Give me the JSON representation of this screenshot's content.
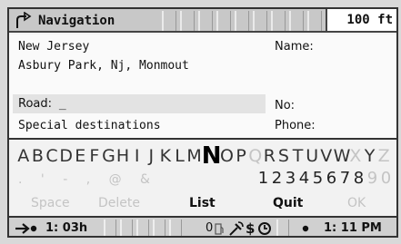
{
  "header": {
    "title": "Navigation",
    "distance": "100 ft",
    "icon": "turn-right-arrow-icon"
  },
  "form": {
    "state": "New Jersey",
    "city": "Asbury Park, Nj, Monmout",
    "road_label": "Road:",
    "road_value": "_",
    "special": "Special destinations",
    "name_label": "Name:",
    "no_label": "No:",
    "phone_label": "Phone:"
  },
  "keyboard": {
    "letters": [
      "A",
      "B",
      "C",
      "D",
      "E",
      "F",
      "G",
      "H",
      "I",
      "J",
      "K",
      "L",
      "M",
      "N",
      "O",
      "P",
      "Q",
      "R",
      "S",
      "T",
      "U",
      "V",
      "W",
      "X",
      "Y",
      "Z"
    ],
    "selected_letter": "N",
    "disabled_letters": [
      "Q",
      "X",
      "Z"
    ],
    "symbols": ". ' - , @ &",
    "digits": [
      "1",
      "2",
      "3",
      "4",
      "5",
      "6",
      "7",
      "8",
      "9",
      "0"
    ],
    "disabled_digits": [
      "9",
      "0"
    ],
    "actions": {
      "space": "Space",
      "delete": "Delete",
      "list": "List",
      "quit": "Quit",
      "ok": "OK"
    }
  },
  "status": {
    "eta": "1: 03h",
    "eta_icon": "arrow-to-destination-icon",
    "fuel": "0",
    "icons": [
      "gas-station-icon",
      "satellite-icon",
      "dollar-icon",
      "clock-icon"
    ],
    "dollar": "$",
    "time": "1: 11 PM"
  }
}
